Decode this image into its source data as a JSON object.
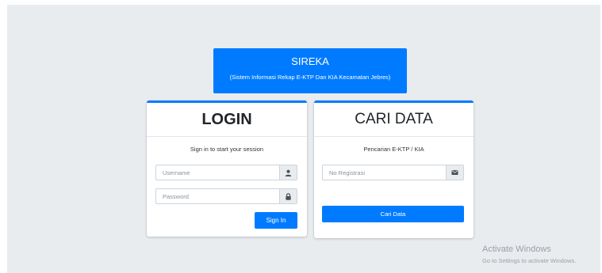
{
  "header": {
    "title": "SIREKA",
    "subtitle": "(Sistem Informasi Rekap E-KTP Dan KIA Kecamatan Jebres)"
  },
  "login": {
    "title": "LOGIN",
    "message": "Sign in to start your session",
    "username_placeholder": "Username",
    "password_placeholder": "Password",
    "username_icon": "user-icon",
    "password_icon": "lock-icon",
    "signin_label": "Sign In"
  },
  "search": {
    "title": "CARI DATA",
    "message": "Pencarian E-KTP / KIA",
    "registration_placeholder": "No Registrasi",
    "registration_icon": "envelope-icon",
    "button_label": "Cari Data"
  },
  "watermark": {
    "title": "Activate Windows",
    "subtitle": "Go to Settings to activate Windows."
  },
  "colors": {
    "primary": "#007bff",
    "background": "#e9ecef"
  }
}
